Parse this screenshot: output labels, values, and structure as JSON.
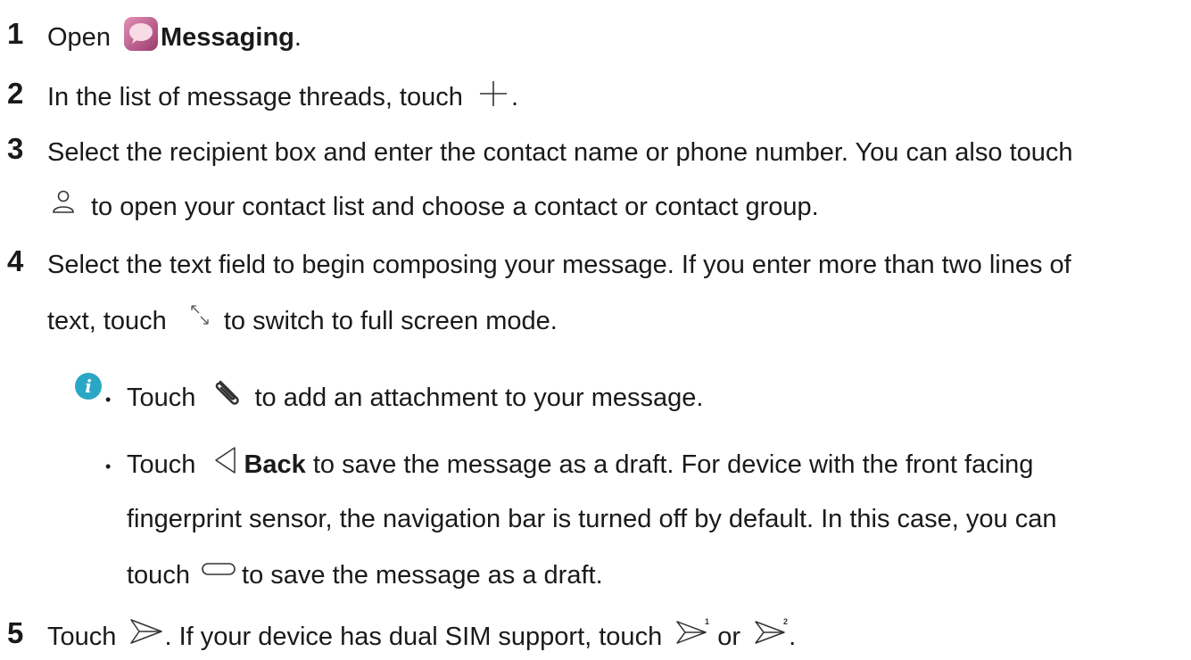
{
  "steps": [
    {
      "number": "1",
      "pre": "Open",
      "bold": "Messaging",
      "post": ".",
      "icon": "messaging-app-icon"
    },
    {
      "number": "2",
      "text": "In the list of message threads, touch",
      "post": ".",
      "icon": "plus-icon"
    },
    {
      "number": "3",
      "line1": "Select the recipient box and enter the contact name or phone number. You can also touch",
      "line2": "to open your contact list and choose a contact or contact group.",
      "icon": "contact-icon"
    },
    {
      "number": "4",
      "line1": "Select the text field to begin composing your message. If you enter more than two lines of",
      "line2_pre": "text, touch",
      "line2_post": "to switch to full screen mode.",
      "icon": "expand-icon"
    }
  ],
  "notes": {
    "icon": "info-icon",
    "bullet1_pre": "Touch",
    "bullet1_post": "to add an attachment to your message.",
    "bullet1_icon": "paperclip-icon",
    "bullet2_pre": "Touch",
    "bullet2_bold": "Back",
    "bullet2_line1_post": "to save the message as a draft. For device with the front facing",
    "bullet2_line2": "fingerprint sensor, the navigation bar is turned off by default. In this case, you can",
    "bullet2_line3_pre": "touch",
    "bullet2_line3_post": "to save the message as a draft.",
    "bullet2_icons": [
      "back-icon",
      "home-pill-icon"
    ],
    "bullet_char": "•"
  },
  "step5": {
    "number": "5",
    "pre": "Touch",
    "mid": ". If your device has dual SIM support, touch",
    "or": "or",
    "post": ".",
    "icons": [
      "send-icon",
      "send-sim1-icon",
      "send-sim2-icon"
    ],
    "sim_labels": [
      "1",
      "2"
    ]
  },
  "colors": {
    "text": "#1a1a1a",
    "info_badge": "#2aa7c4",
    "icon_stroke": "#333333",
    "messaging_icon": "#b85a8c"
  }
}
